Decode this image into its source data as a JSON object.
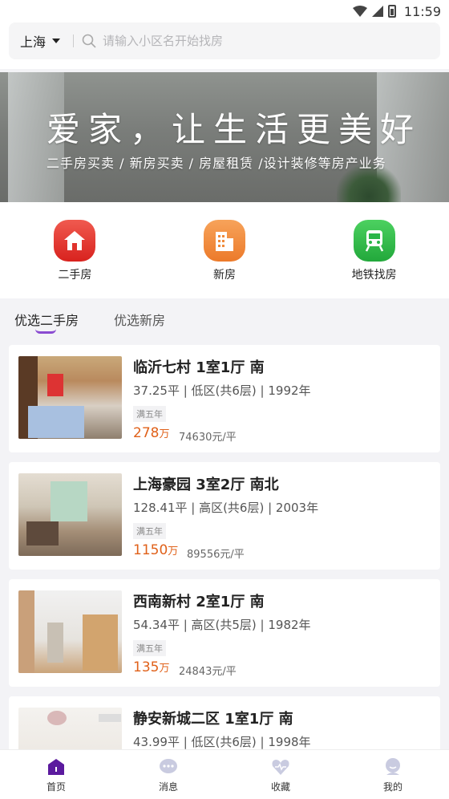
{
  "status_bar": {
    "time": "11:59"
  },
  "search": {
    "city": "上海",
    "placeholder": "请输入小区名开始找房"
  },
  "banner": {
    "title": "爱家，让生活更美好",
    "subtitle": "二手房买卖 / 新房买卖 / 房屋租赁 /设计装修等房产业务"
  },
  "quick_nav": [
    {
      "label": "二手房",
      "icon": "house-icon",
      "color": "#e8322e"
    },
    {
      "label": "新房",
      "icon": "building-icon",
      "color": "#f08a3a"
    },
    {
      "label": "地铁找房",
      "icon": "subway-icon",
      "color": "#2bb548"
    }
  ],
  "tabs": [
    {
      "label": "优选二手房",
      "active": true
    },
    {
      "label": "优选新房",
      "active": false
    }
  ],
  "listings": [
    {
      "title": "临沂七村 1室1厅 南",
      "meta": "37.25平 | 低区(共6层) | 1992年",
      "tag": "满五年",
      "price": "278",
      "price_unit": "万",
      "unit_price": "74630元/平"
    },
    {
      "title": "上海豪园 3室2厅 南北",
      "meta": "128.41平 | 高区(共6层) | 2003年",
      "tag": "满五年",
      "price": "1150",
      "price_unit": "万",
      "unit_price": "89556元/平"
    },
    {
      "title": "西南新村 2室1厅 南",
      "meta": "54.34平 | 高区(共5层) | 1982年",
      "tag": "满五年",
      "price": "135",
      "price_unit": "万",
      "unit_price": "24843元/平"
    },
    {
      "title": "静安新城二区 1室1厅 南",
      "meta": "43.99平 | 低区(共6层) | 1998年",
      "tag": "",
      "price": "",
      "price_unit": "",
      "unit_price": ""
    }
  ],
  "bottom_nav": [
    {
      "label": "首页",
      "icon": "home-icon",
      "active": true
    },
    {
      "label": "消息",
      "icon": "message-icon",
      "active": false
    },
    {
      "label": "收藏",
      "icon": "favorite-icon",
      "active": false
    },
    {
      "label": "我的",
      "icon": "profile-icon",
      "active": false
    }
  ],
  "colors": {
    "accent": "#6a1fb0",
    "price": "#e0611a"
  }
}
